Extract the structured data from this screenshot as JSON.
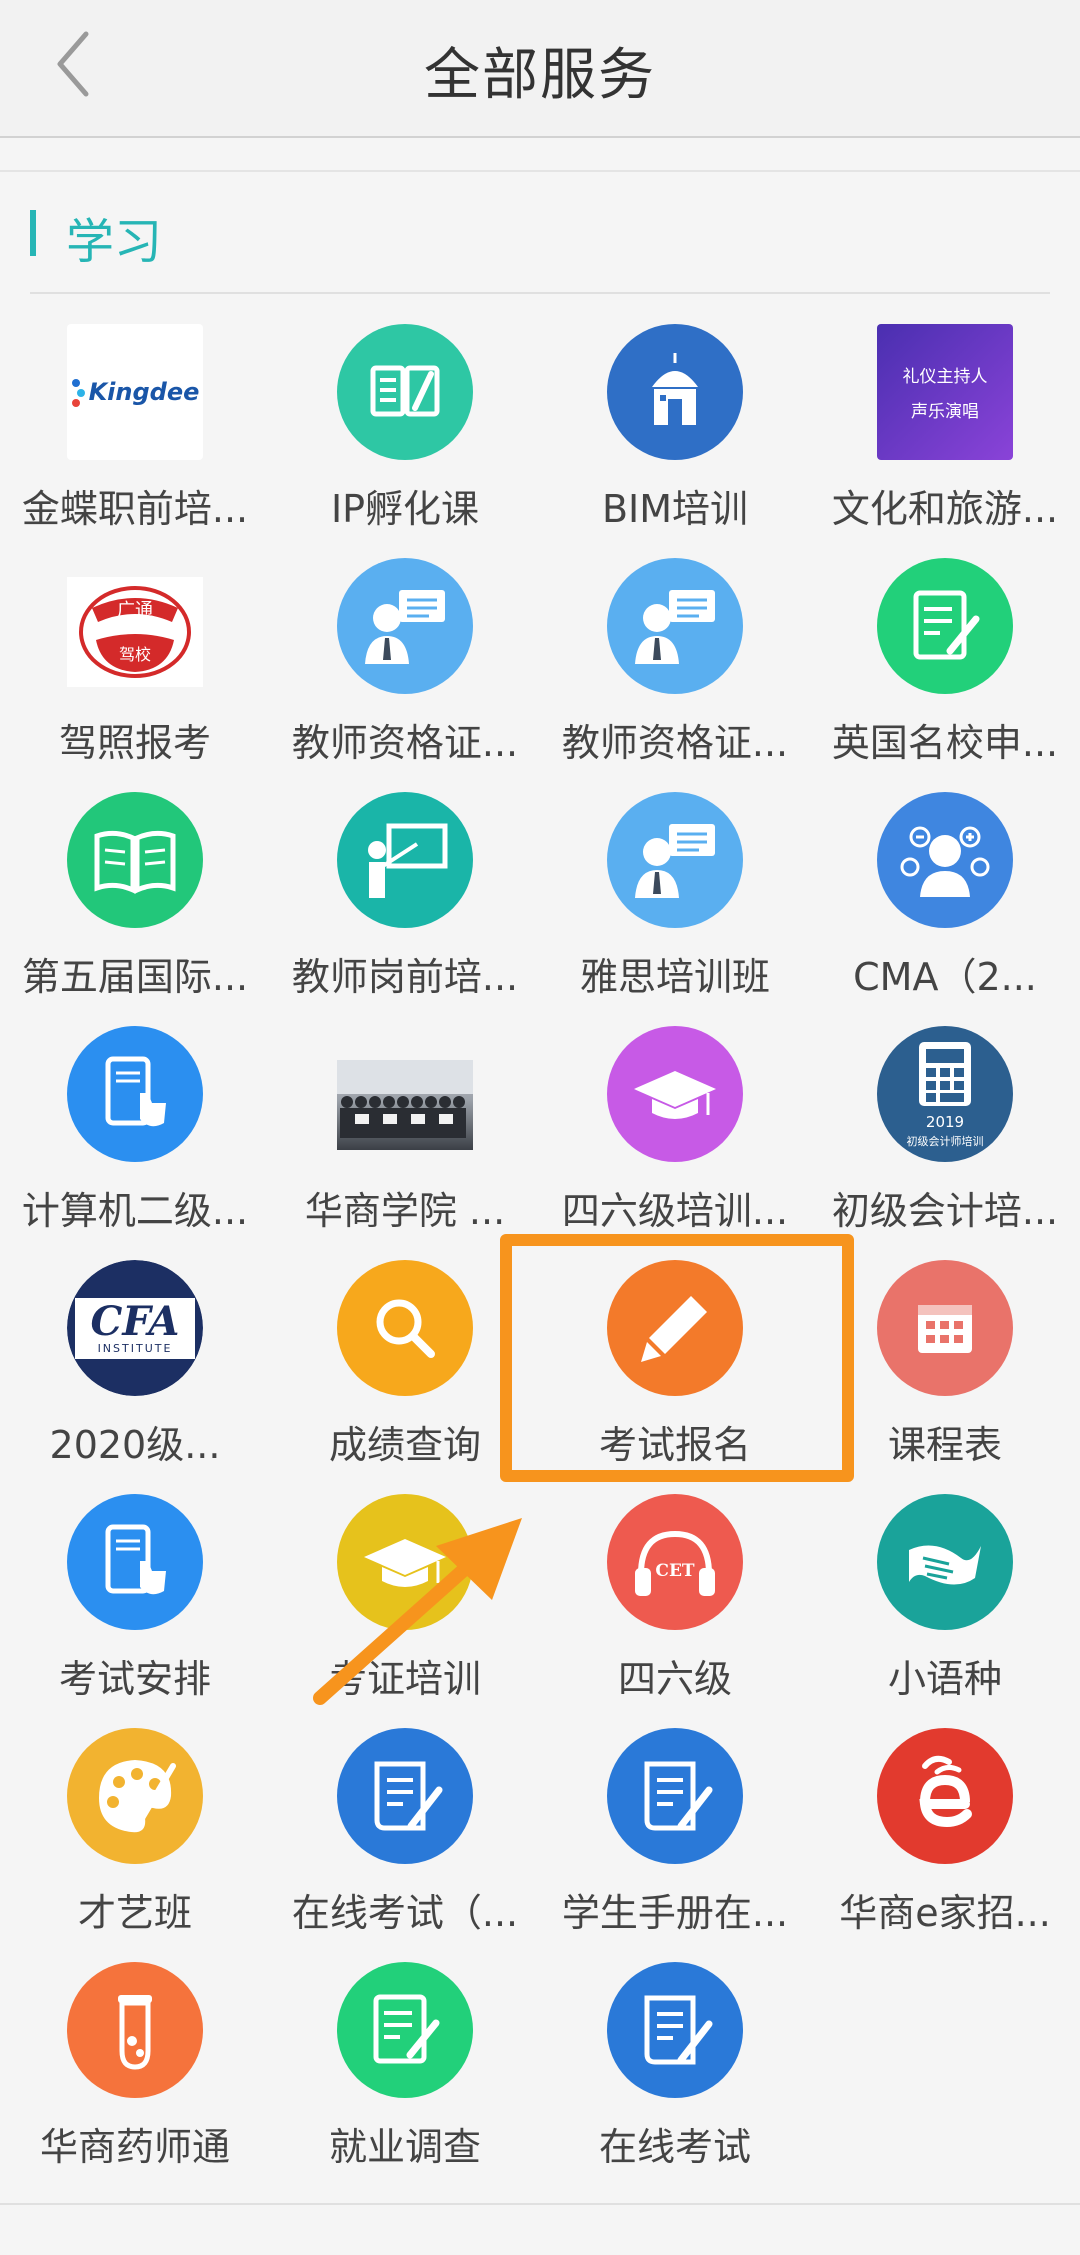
{
  "header": {
    "title": "全部服务"
  },
  "section": {
    "title": "学习"
  },
  "services": [
    {
      "label": "金蝶职前培...",
      "icon": "kingdee-logo",
      "logo_text": "Kingdee"
    },
    {
      "label": "IP孵化课",
      "icon": "book-pen-icon",
      "color": "#2ec7a4"
    },
    {
      "label": "BIM培训",
      "icon": "observatory-icon",
      "color": "#2f6fc6"
    },
    {
      "label": "文化和旅游...",
      "icon": "poster-thumbnail",
      "line1": "礼仪主持人",
      "line2": "声乐演唱"
    },
    {
      "label": "驾照报考",
      "icon": "driving-school-logo",
      "top_text": "广通",
      "bottom_text": "驾校"
    },
    {
      "label": "教师资格证...",
      "icon": "teacher-speech-icon",
      "color": "#5aaff0"
    },
    {
      "label": "教师资格证...",
      "icon": "teacher-speech-icon",
      "color": "#5aaff0"
    },
    {
      "label": "英国名校申...",
      "icon": "document-edit-icon",
      "color": "#22d07a"
    },
    {
      "label": "第五届国际...",
      "icon": "open-book-icon",
      "color": "#22c77a"
    },
    {
      "label": "教师岗前培...",
      "icon": "teacher-board-icon",
      "color": "#1ab5a8"
    },
    {
      "label": "雅思培训班",
      "icon": "teacher-speech-icon",
      "color": "#5aaff0"
    },
    {
      "label": "CMA（2...",
      "icon": "person-plus-icon",
      "color": "#3f86e0"
    },
    {
      "label": "计算机二级...",
      "icon": "tablet-touch-icon",
      "color": "#2b8ff0"
    },
    {
      "label": "华商学院 ...",
      "icon": "group-photo-thumbnail"
    },
    {
      "label": "四六级培训...",
      "icon": "graduation-cap-icon",
      "color": "#c75ae6"
    },
    {
      "label": "初级会计培...",
      "icon": "calculator-icon",
      "color": "#2c5f8f",
      "year": "2019",
      "caption": "初级会计师培训"
    },
    {
      "label": "2020级...",
      "icon": "cfa-logo",
      "logo_text": "CFA",
      "sub_text": "INSTITUTE"
    },
    {
      "label": "成绩查询",
      "icon": "search-icon",
      "color": "#f7a81c"
    },
    {
      "label": "考试报名",
      "icon": "pencil-icon",
      "color": "#f37a2a"
    },
    {
      "label": "课程表",
      "icon": "calendar-icon",
      "color": "#e9736a"
    },
    {
      "label": "考试安排",
      "icon": "tablet-touch-icon",
      "color": "#2b8ff0"
    },
    {
      "label": "考证培训",
      "icon": "graduation-cap-icon",
      "color": "#e6c21c"
    },
    {
      "label": "四六级",
      "icon": "headphones-cet-icon",
      "color": "#ee5a4f",
      "badge": "CET"
    },
    {
      "label": "小语种",
      "icon": "open-page-icon",
      "color": "#1aa39a"
    },
    {
      "label": "才艺班",
      "icon": "palette-icon",
      "color": "#f2b330"
    },
    {
      "label": "在线考试（...",
      "icon": "scroll-edit-icon",
      "color": "#2a79d8"
    },
    {
      "label": "学生手册在...",
      "icon": "scroll-edit-icon",
      "color": "#2a79d8"
    },
    {
      "label": "华商e家招...",
      "icon": "e-logo-icon",
      "color": "#e23a2e"
    },
    {
      "label": "华商药师通",
      "icon": "test-tube-icon",
      "color": "#f5733c"
    },
    {
      "label": "就业调查",
      "icon": "document-edit-icon",
      "color": "#22d07a"
    },
    {
      "label": "在线考试",
      "icon": "scroll-edit-icon",
      "color": "#2a79d8"
    }
  ],
  "highlight": {
    "target": "考试报名",
    "color": "#f7941d"
  }
}
